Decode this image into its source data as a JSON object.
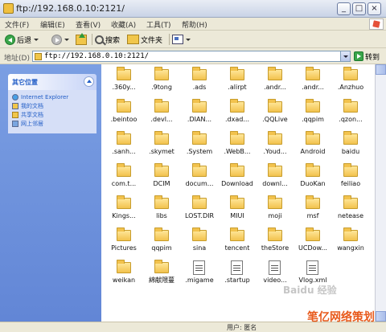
{
  "window": {
    "title": "ftp://192.168.0.10:2121/"
  },
  "menu": [
    "文件(F)",
    "编辑(E)",
    "查看(V)",
    "收藏(A)",
    "工具(T)",
    "帮助(H)"
  ],
  "toolbar": {
    "back_label": "后退",
    "search_label": "搜索",
    "folders_label": "文件夹"
  },
  "address": {
    "label": "地址(D)",
    "value": "ftp://192.168.0.10:2121/",
    "go_label": "转到"
  },
  "taskpane": {
    "title": "其它位置",
    "items": [
      {
        "label": "Internet Explorer",
        "icon": "ie-icon"
      },
      {
        "label": "我的文档",
        "icon": "my-documents-icon"
      },
      {
        "label": "共享文档",
        "icon": "shared-documents-icon"
      },
      {
        "label": "网上邻居",
        "icon": "network-places-icon"
      }
    ]
  },
  "files": [
    {
      "name": ".360y...",
      "type": "folder"
    },
    {
      "name": ".9tong",
      "type": "folder"
    },
    {
      "name": ".ads",
      "type": "folder"
    },
    {
      "name": ".alirpt",
      "type": "folder"
    },
    {
      "name": ".andr...",
      "type": "folder"
    },
    {
      "name": ".andr...",
      "type": "folder"
    },
    {
      "name": ".Anzhuo",
      "type": "folder"
    },
    {
      "name": ".beintoo",
      "type": "folder"
    },
    {
      "name": ".devl...",
      "type": "folder"
    },
    {
      "name": ".DIAN...",
      "type": "folder"
    },
    {
      "name": ".dxad...",
      "type": "folder"
    },
    {
      "name": ".QQLive",
      "type": "folder"
    },
    {
      "name": ".qqpim",
      "type": "folder"
    },
    {
      "name": ".qzon...",
      "type": "folder"
    },
    {
      "name": ".sanh...",
      "type": "folder"
    },
    {
      "name": ".skymet",
      "type": "folder"
    },
    {
      "name": ".System",
      "type": "folder"
    },
    {
      "name": ".WebB...",
      "type": "folder"
    },
    {
      "name": ".Youd...",
      "type": "folder"
    },
    {
      "name": "Android",
      "type": "folder"
    },
    {
      "name": "baidu",
      "type": "folder"
    },
    {
      "name": "com.t...",
      "type": "folder"
    },
    {
      "name": "DCIM",
      "type": "folder"
    },
    {
      "name": "docum...",
      "type": "folder"
    },
    {
      "name": "Download",
      "type": "folder"
    },
    {
      "name": "downl...",
      "type": "folder"
    },
    {
      "name": "DuoKan",
      "type": "folder"
    },
    {
      "name": "feiliao",
      "type": "folder"
    },
    {
      "name": "Kings...",
      "type": "folder"
    },
    {
      "name": "libs",
      "type": "folder"
    },
    {
      "name": "LOST.DIR",
      "type": "folder"
    },
    {
      "name": "MIUI",
      "type": "folder"
    },
    {
      "name": "moji",
      "type": "folder"
    },
    {
      "name": "msf",
      "type": "folder"
    },
    {
      "name": "netease",
      "type": "folder"
    },
    {
      "name": "Pictures",
      "type": "folder"
    },
    {
      "name": "qqpim",
      "type": "folder"
    },
    {
      "name": "sina",
      "type": "folder"
    },
    {
      "name": "tencent",
      "type": "folder"
    },
    {
      "name": "theStore",
      "type": "folder"
    },
    {
      "name": "UCDow...",
      "type": "folder"
    },
    {
      "name": "wangxin",
      "type": "folder"
    },
    {
      "name": "weikan",
      "type": "folder"
    },
    {
      "name": "綿献隈蔓",
      "type": "folder"
    },
    {
      "name": ".migame",
      "type": "file"
    },
    {
      "name": ".startup",
      "type": "file"
    },
    {
      "name": "video...",
      "type": "file"
    },
    {
      "name": "Vlog.xml",
      "type": "file"
    }
  ],
  "status": {
    "text": "用户: 匿名"
  },
  "watermark": {
    "baidu": "Baidu 经验",
    "site": "笔亿网络策划"
  }
}
